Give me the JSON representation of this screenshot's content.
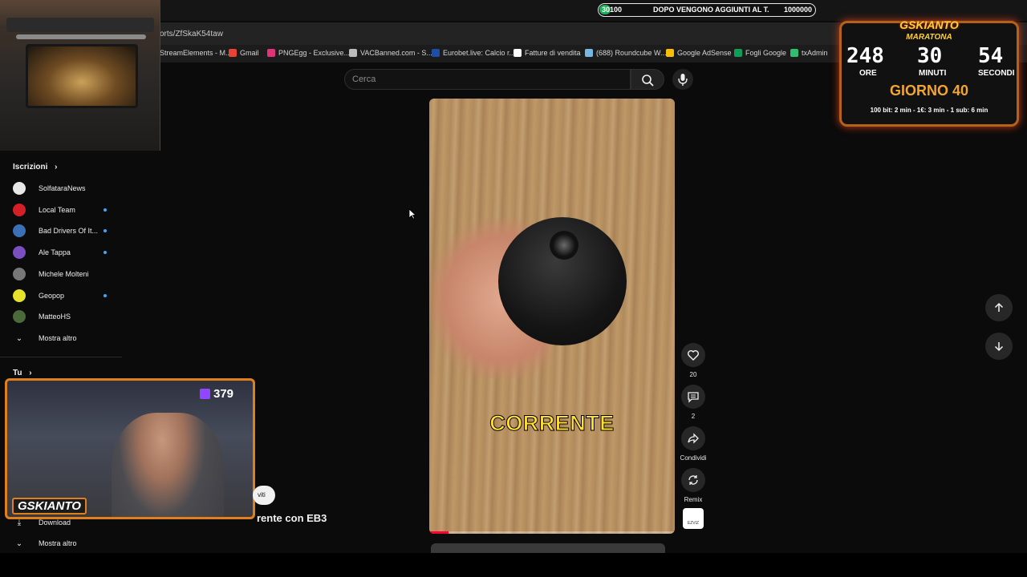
{
  "browser": {
    "url_partial": "orts/ZfSkaK54taw",
    "bookmarks": [
      {
        "label": "StreamElements - M...",
        "color": "#1a8fe3"
      },
      {
        "label": "Gmail",
        "color": "#ea4335"
      },
      {
        "label": "PNGEgg - Exclusive...",
        "color": "#e0347a"
      },
      {
        "label": "VACBanned.com - S...",
        "color": "#bbbbbb"
      },
      {
        "label": "Eurobet.live: Calcio r...",
        "color": "#1d4fa8"
      },
      {
        "label": "Fatture di vendita",
        "color": "#ffffff"
      },
      {
        "label": "(688) Roundcube W...",
        "color": "#79b7e3"
      },
      {
        "label": "Google AdSense",
        "color": "#fbbc05"
      },
      {
        "label": "Fogli Google",
        "color": "#0f9d58"
      },
      {
        "label": "txAdmin",
        "color": "#2fbf71"
      }
    ]
  },
  "goal_bar": {
    "current": "30100",
    "text": "DOPO VENGONO AGGIUNTI AL T.",
    "target": "1000000",
    "progress_fraction": 0.03
  },
  "search": {
    "placeholder": "Cerca"
  },
  "sidebar": {
    "subscriptions_title": "Iscrizioni",
    "subscriptions": [
      {
        "name": "SolfataraNews",
        "avatar_color": "#e8e8e8",
        "live": false
      },
      {
        "name": "Local Team",
        "avatar_color": "#d51f26",
        "live": true
      },
      {
        "name": "Bad Drivers Of It...",
        "avatar_color": "#3c6fb6",
        "live": true
      },
      {
        "name": "Ale Tappa",
        "avatar_color": "#7b4fbf",
        "live": true
      },
      {
        "name": "Michele Molteni",
        "avatar_color": "#777777",
        "live": false
      },
      {
        "name": "Geopop",
        "avatar_color": "#e6e12b",
        "live": true
      },
      {
        "name": "MatteoHS",
        "avatar_color": "#4b6a3a",
        "live": false
      }
    ],
    "show_more": "Mostra altro",
    "you_title": "Tu",
    "download": "Download",
    "show_more_2": "Mostra altro"
  },
  "webcam": {
    "viewer_count": "379",
    "brand": "GSKIANTO"
  },
  "timer": {
    "title": "GSKIANTO",
    "subtitle": "MARATONA",
    "hours": "248",
    "minutes": "30",
    "seconds": "54",
    "hours_label": "ORE",
    "minutes_label": "MINUTI",
    "seconds_label": "SECONDI",
    "day": "GIORNO 40",
    "rates": "100 bit: 2 min - 1€: 3 min - 1 sub: 6 min"
  },
  "video": {
    "caption": "CORRENTE",
    "title_fragment": "rente con EB3",
    "chip_text": "viti",
    "progress_fraction": 0.08
  },
  "actions": {
    "likes": "20",
    "comments": "2",
    "share_label": "Condividi",
    "remix_label": "Remix",
    "channel_logo_text": "EZVIZ"
  }
}
